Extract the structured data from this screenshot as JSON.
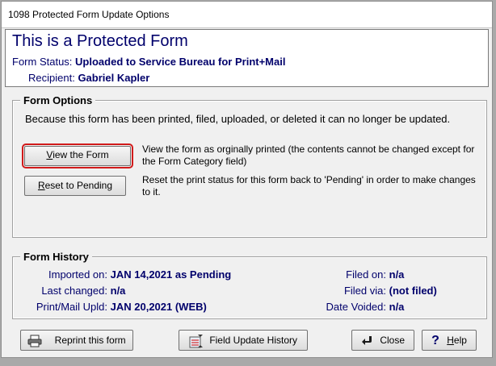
{
  "window": {
    "title": "1098 Protected Form Update Options"
  },
  "header": {
    "heading": "This is a Protected Form",
    "status_label": "Form Status:",
    "status_value": "Uploaded to Service Bureau for Print+Mail",
    "recipient_label": "Recipient:",
    "recipient_value": "Gabriel Kapler"
  },
  "options": {
    "legend": "Form Options",
    "description": "Because this form has been printed, filed, uploaded, or deleted  it can no longer be updated.",
    "view_button": {
      "mnemonic": "V",
      "rest": "iew the Form"
    },
    "view_text": "View the form as orginally printed (the contents cannot be changed except for the Form Category field)",
    "reset_button": {
      "mnemonic": "R",
      "rest": "eset to Pending"
    },
    "reset_text": "Reset the print status for this form back to 'Pending' in order to make changes to it."
  },
  "history": {
    "legend": "Form History",
    "imported_label": "Imported on:",
    "imported_value": "JAN 14,2021 as Pending",
    "changed_label": "Last changed:",
    "changed_value": "n/a",
    "upld_label": "Print/Mail Upld:",
    "upld_value": "JAN 20,2021 (WEB)",
    "filed_on_label": "Filed on:",
    "filed_on_value": "n/a",
    "filed_via_label": "Filed via:",
    "filed_via_value": "(not filed)",
    "voided_label": "Date Voided:",
    "voided_value": "n/a"
  },
  "footer": {
    "reprint": "Reprint this form",
    "field_history": "Field Update History",
    "close": "Close",
    "help": {
      "mnemonic": "H",
      "rest": "elp"
    }
  },
  "icons": {
    "printer": "printer-icon",
    "history": "field-history-icon",
    "close": "close-arrow-icon",
    "help": "help-question-icon"
  }
}
